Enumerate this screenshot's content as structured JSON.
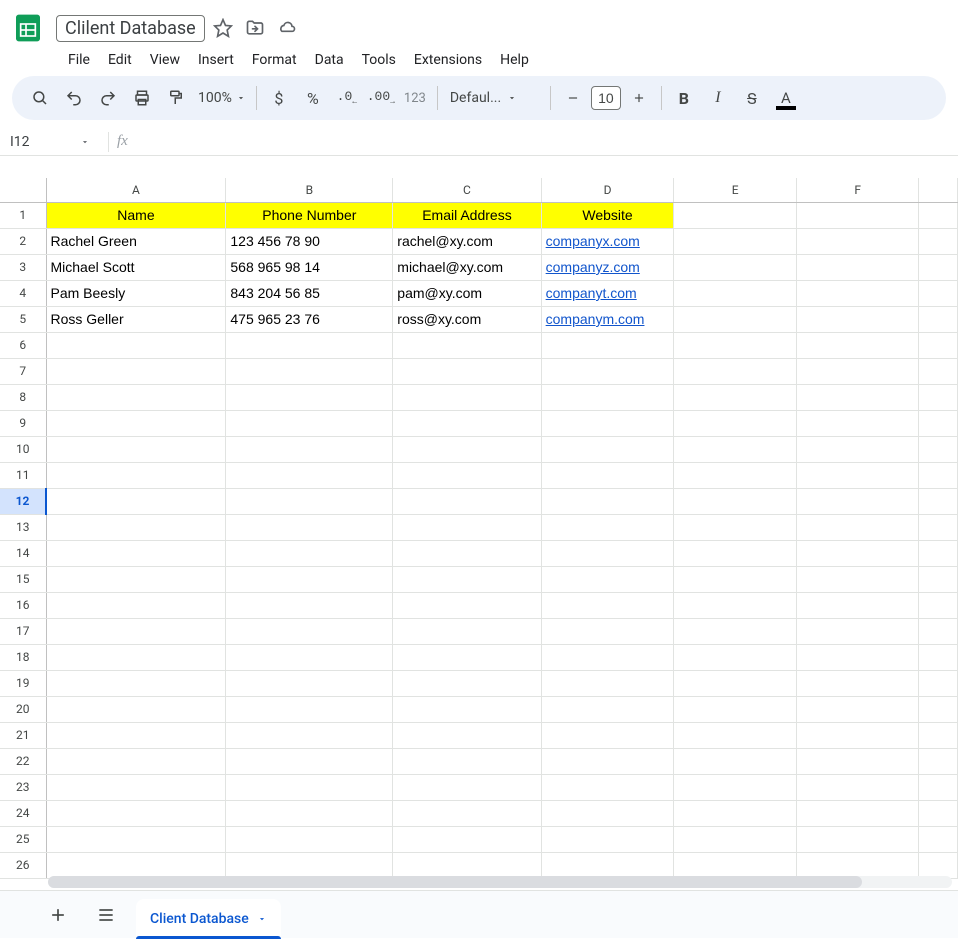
{
  "doc_title": "Clilent Database",
  "menus": [
    "File",
    "Edit",
    "View",
    "Insert",
    "Format",
    "Data",
    "Tools",
    "Extensions",
    "Help"
  ],
  "zoom": "100%",
  "font_name": "Defaul...",
  "font_size": "10",
  "name_box": "I12",
  "formula": "",
  "columns": [
    "A",
    "B",
    "C",
    "D",
    "E",
    "F"
  ],
  "active_row": 12,
  "total_rows": 26,
  "headers": [
    "Name",
    "Phone Number",
    "Email Address",
    "Website"
  ],
  "rows": [
    {
      "name": "Rachel Green",
      "phone": "123 456 78 90",
      "email": "rachel@xy.com",
      "website": "companyx.com"
    },
    {
      "name": "Michael Scott",
      "phone": "568 965 98 14",
      "email": "michael@xy.com",
      "website": "companyz.com"
    },
    {
      "name": "Pam Beesly",
      "phone": "843 204 56 85",
      "email": "pam@xy.com",
      "website": "companyt.com"
    },
    {
      "name": "Ross Geller",
      "phone": "475 965 23 76",
      "email": "ross@xy.com",
      "website": "companym.com"
    }
  ],
  "sheet_tab": "Client Database"
}
